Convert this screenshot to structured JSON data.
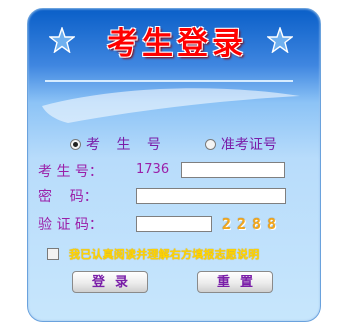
{
  "title": "考生登录",
  "login_type": {
    "options": [
      {
        "label": "考 生 号",
        "checked": true
      },
      {
        "label": "准考证号",
        "checked": false
      }
    ]
  },
  "form": {
    "exam_number": {
      "label": "考 生 号：",
      "prefix": "1736",
      "value": ""
    },
    "password": {
      "label": "密    码：",
      "value": ""
    },
    "captcha": {
      "label": "验 证 码：",
      "value": "",
      "code": "2288"
    }
  },
  "agree": {
    "label": "我已认真阅读并理解右方填报志愿说明",
    "checked": false
  },
  "buttons": {
    "login": "登录",
    "reset": "重置"
  },
  "icons": {
    "star": "star-icon"
  },
  "colors": {
    "title": "#ff0000",
    "label": "#9b1fa8",
    "agree_text": "#ffd400",
    "captcha": "#f2a71e"
  }
}
